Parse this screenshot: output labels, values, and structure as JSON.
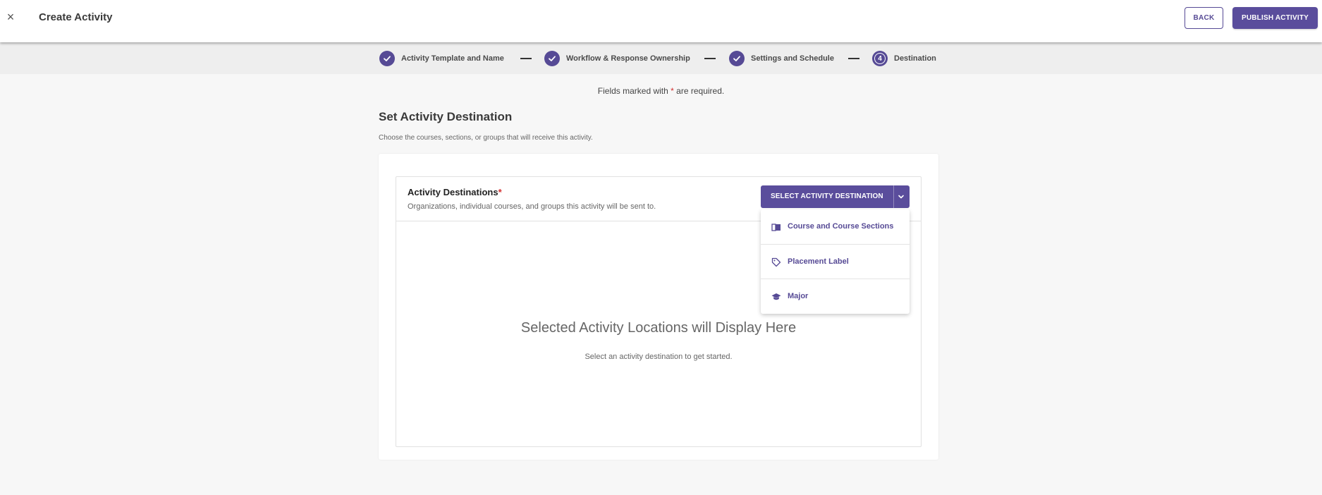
{
  "header": {
    "close_icon": "×",
    "title": "Create Activity",
    "back_label": "BACK",
    "publish_label": "PUBLISH ACTIVITY"
  },
  "stepper": {
    "steps": [
      {
        "label": "Activity Template and Name",
        "status": "complete"
      },
      {
        "label": "Workflow & Response Ownership",
        "status": "complete"
      },
      {
        "label": "Settings and Schedule",
        "status": "complete"
      },
      {
        "label": "Destination",
        "status": "current",
        "number": "4"
      }
    ]
  },
  "required_note": {
    "prefix": "Fields marked with",
    "star": "*",
    "suffix": "are required."
  },
  "section": {
    "title": "Set Activity Destination",
    "description": "Choose the courses, sections, or groups that will receive this activity."
  },
  "destinations": {
    "title": "Activity Destinations",
    "required_star": "*",
    "subtitle": "Organizations, individual courses, and groups this activity will be sent to.",
    "select_label": "SELECT ACTIVITY DESTINATION",
    "menu": [
      {
        "label": "Course and Course Sections",
        "icon": "book-icon"
      },
      {
        "label": "Placement Label",
        "icon": "tag-icon"
      },
      {
        "label": "Major",
        "icon": "graduation-cap-icon"
      }
    ],
    "empty_title": "Selected Activity Locations will Display Here",
    "empty_subtitle": "Select an activity destination to get started."
  },
  "colors": {
    "accent": "#5a4d9c",
    "required": "#d32f2f"
  }
}
